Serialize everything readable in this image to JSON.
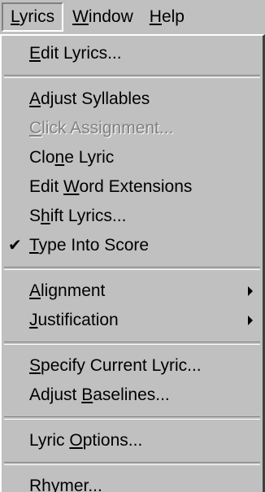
{
  "menubar": {
    "items": [
      {
        "pre": "",
        "key": "L",
        "post": "yrics"
      },
      {
        "pre": "",
        "key": "W",
        "post": "indow"
      },
      {
        "pre": "",
        "key": "H",
        "post": "elp"
      }
    ]
  },
  "menu": {
    "edit_lyrics": {
      "pre": "",
      "key": "E",
      "post": "dit Lyrics..."
    },
    "adjust_syllables": {
      "pre": "",
      "key": "A",
      "post": "djust Syllables"
    },
    "click_assignment": {
      "pre": "",
      "key": "C",
      "post": "lick Assignment..."
    },
    "clone_lyric": {
      "pre": "Clo",
      "key": "n",
      "post": "e Lyric"
    },
    "edit_word_extensions": {
      "pre": "Edit ",
      "key": "W",
      "post": "ord Extensions"
    },
    "shift_lyrics": {
      "pre": "S",
      "key": "h",
      "post": "ift Lyrics..."
    },
    "type_into_score": {
      "pre": "",
      "key": "T",
      "post": "ype Into Score",
      "check": "✔"
    },
    "alignment": {
      "pre": "",
      "key": "A",
      "post": "lignment"
    },
    "justification": {
      "pre": "",
      "key": "J",
      "post": "ustification"
    },
    "specify_current_lyric": {
      "pre": "",
      "key": "S",
      "post": "pecify Current Lyric..."
    },
    "adjust_baselines": {
      "pre": "Adjust ",
      "key": "B",
      "post": "aselines..."
    },
    "lyric_options": {
      "pre": "Lyric ",
      "key": "O",
      "post": "ptions..."
    },
    "rhymer": {
      "pre": "Rhymer...",
      "key": "",
      "post": ""
    }
  }
}
